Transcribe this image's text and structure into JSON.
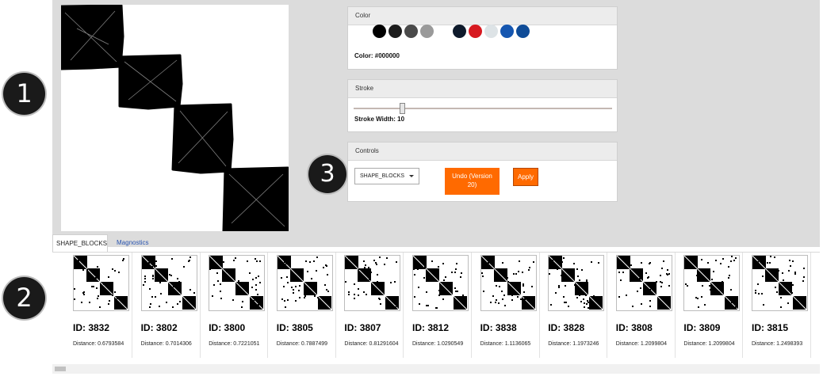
{
  "badges": {
    "one": "1",
    "two": "2",
    "three": "3"
  },
  "color_panel": {
    "header": "Color",
    "current_label": "Color: #000000",
    "swatches": [
      {
        "name": "black",
        "hex": "#000000"
      },
      {
        "name": "near-black",
        "hex": "#1c1c1c"
      },
      {
        "name": "dark-gray",
        "hex": "#4a4a4a"
      },
      {
        "name": "gray",
        "hex": "#9a9a9a"
      },
      {
        "name": "navy",
        "hex": "#0e1a2b"
      },
      {
        "name": "red",
        "hex": "#d71920"
      },
      {
        "name": "light-gray",
        "hex": "#dde3e6"
      },
      {
        "name": "blue",
        "hex": "#1556b0"
      },
      {
        "name": "dark-blue",
        "hex": "#0f4c98"
      }
    ]
  },
  "stroke_panel": {
    "header": "Stroke",
    "width_label": "Stroke Width: 10",
    "width_value": 10
  },
  "controls_panel": {
    "header": "Controls",
    "dropdown_value": "SHAPE_BLOCKS",
    "undo_label": "Undo (Version 20)",
    "apply_label": "Apply"
  },
  "tabs": {
    "active": "SHAPE_BLOCKS",
    "inactive": "Magnostics"
  },
  "results": [
    {
      "id": "ID: 3832",
      "distance": "Distance: 0.6793584"
    },
    {
      "id": "ID: 3802",
      "distance": "Distance: 0.7014306"
    },
    {
      "id": "ID: 3800",
      "distance": "Distance: 0.7221051"
    },
    {
      "id": "ID: 3805",
      "distance": "Distance: 0.7887499"
    },
    {
      "id": "ID: 3807",
      "distance": "Distance: 0.81291604"
    },
    {
      "id": "ID: 3812",
      "distance": "Distance: 1.0290549"
    },
    {
      "id": "ID: 3838",
      "distance": "Distance: 1.1136065"
    },
    {
      "id": "ID: 3828",
      "distance": "Distance: 1.1973246"
    },
    {
      "id": "ID: 3808",
      "distance": "Distance: 1.2099804"
    },
    {
      "id": "ID: 3809",
      "distance": "Distance: 1.2099804"
    },
    {
      "id": "ID: 3815",
      "distance": "Distance: 1.2498393"
    }
  ]
}
